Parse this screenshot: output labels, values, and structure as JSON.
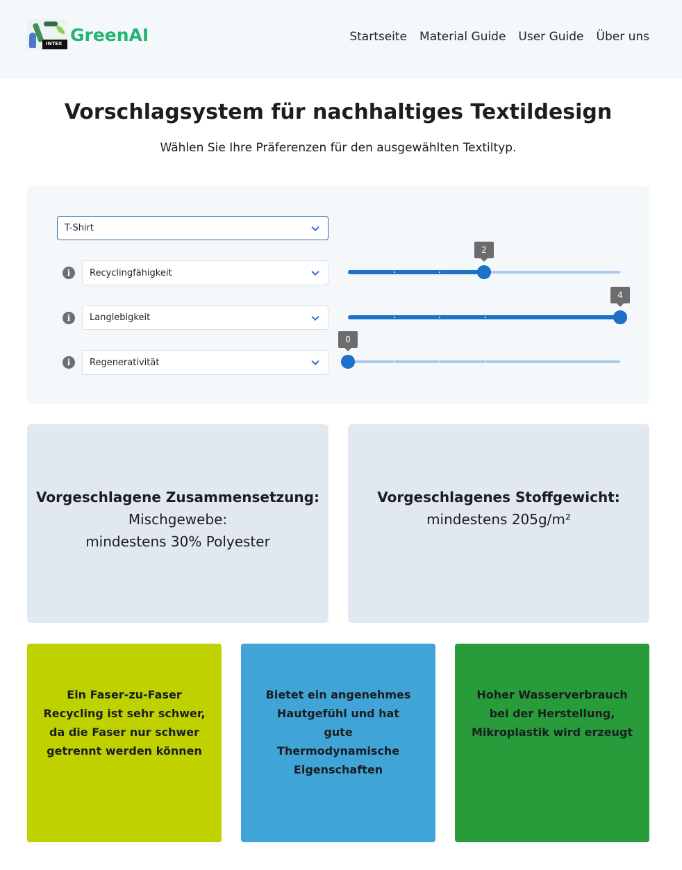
{
  "header": {
    "logo_text": "INTEX",
    "brand": "GreenAI",
    "nav": [
      "Startseite",
      "Material Guide",
      "User Guide",
      "Über uns"
    ]
  },
  "page": {
    "title": "Vorschlagsystem für nachhaltiges Textildesign",
    "subtitle": "Wählen Sie Ihre Präferenzen für den ausgewählten Textiltyp."
  },
  "controls": {
    "textile_type": "T-Shirt",
    "criteria": [
      {
        "label": "Recyclingfähigkeit",
        "value": 2,
        "min": 0,
        "max": 4
      },
      {
        "label": "Langlebigkeit",
        "value": 4,
        "min": 0,
        "max": 4
      },
      {
        "label": "Regenerativität",
        "value": 0,
        "min": 0,
        "max": 4
      }
    ],
    "accent_color": "#1a73c9"
  },
  "results": {
    "composition": {
      "heading": "Vorgeschlagene Zusammensetzung:",
      "line1": "Mischgewebe:",
      "line2": "mindestens 30% Polyester"
    },
    "weight": {
      "heading": "Vorgeschlagenes Stoffgewicht:",
      "value": "mindestens 205g/m²"
    }
  },
  "notes": [
    {
      "text": "Ein Faser-zu-Faser Recycling ist sehr schwer, da die Faser nur schwer getrennt werden können",
      "color": "#bfd200"
    },
    {
      "text": "Bietet ein angenehmes Hautgefühl und hat gute Thermodynamische Eigenschaften",
      "color": "#41a4d6"
    },
    {
      "text": "Hoher Wasserverbrauch bei der Herstellung, Mikroplastik wird erzeugt",
      "color": "#289b3a"
    }
  ]
}
